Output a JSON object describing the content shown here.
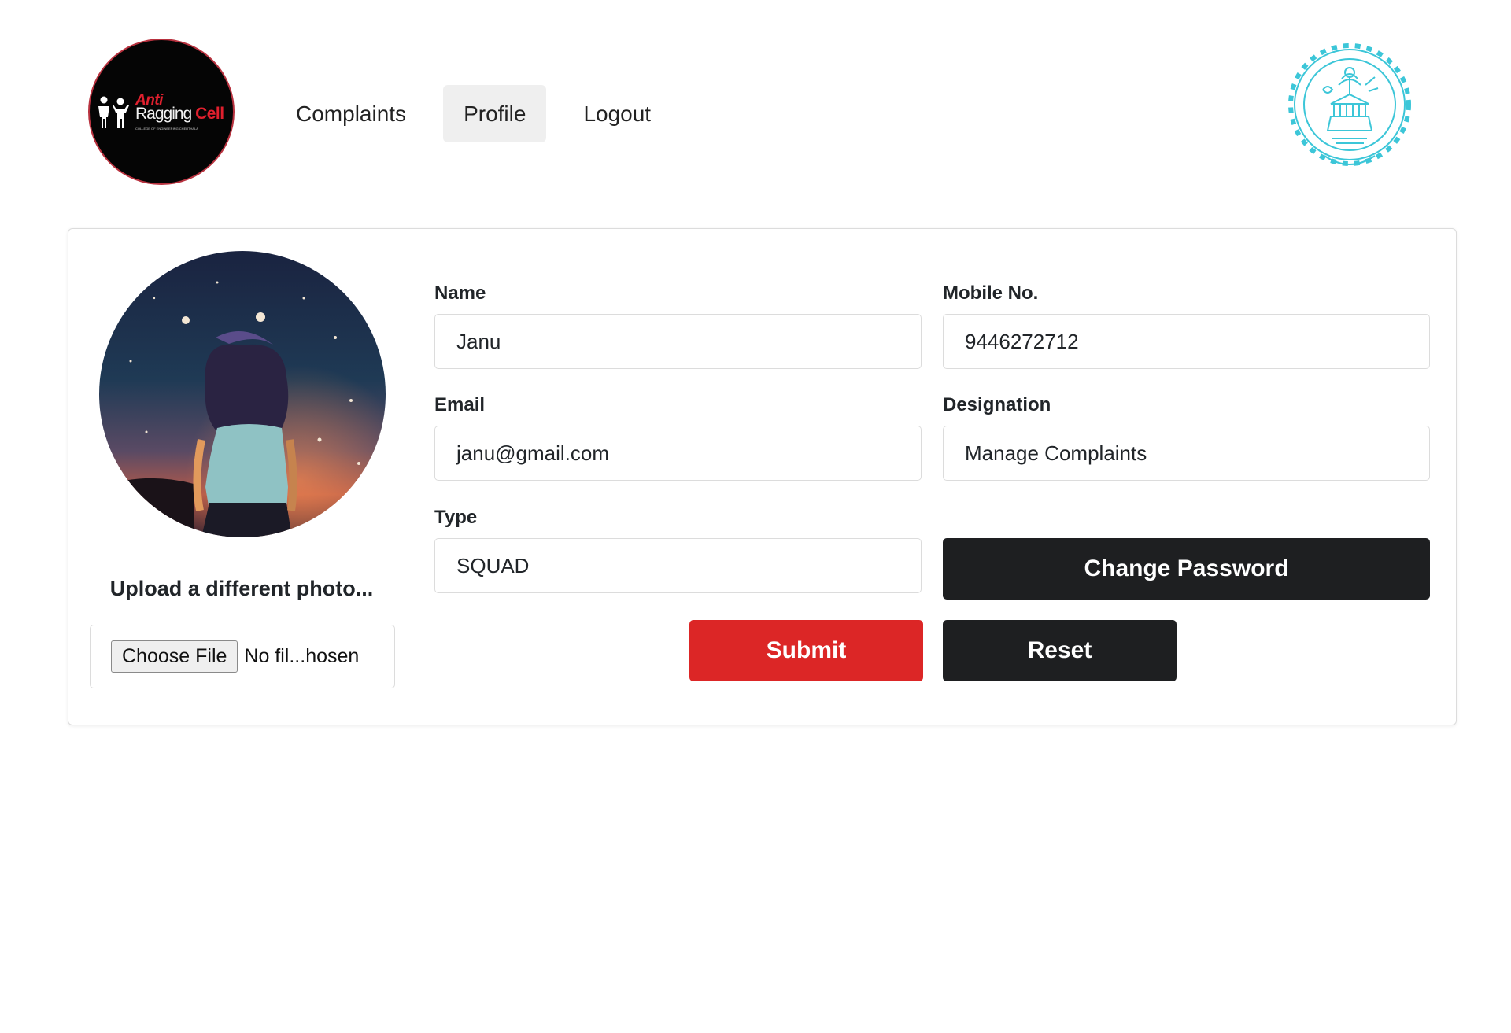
{
  "brand": {
    "logo_word1": "Anti",
    "logo_word2_a": "Ragging",
    "logo_word2_b": "Cell",
    "logo_tagline": "COLLEGE OF ENGINEERING CHERTHALA"
  },
  "nav": {
    "items": [
      {
        "label": "Complaints",
        "active": false
      },
      {
        "label": "Profile",
        "active": true
      },
      {
        "label": "Logout",
        "active": false
      }
    ]
  },
  "profile": {
    "upload_label": "Upload a different photo...",
    "file_button": "Choose File",
    "file_status": "No fil...hosen",
    "fields": {
      "name": {
        "label": "Name",
        "value": "Janu"
      },
      "mobile": {
        "label": "Mobile No.",
        "value": "9446272712"
      },
      "email": {
        "label": "Email",
        "value": "janu@gmail.com"
      },
      "designation": {
        "label": "Designation",
        "value": "Manage Complaints"
      },
      "type": {
        "label": "Type",
        "value": "SQUAD"
      }
    },
    "buttons": {
      "change_password": "Change Password",
      "submit": "Submit",
      "reset": "Reset"
    }
  },
  "colors": {
    "primary_dark": "#1e1f21",
    "submit_red": "#dc2626",
    "active_nav_bg": "#efefef",
    "seal_cyan": "#3cc6d8"
  }
}
